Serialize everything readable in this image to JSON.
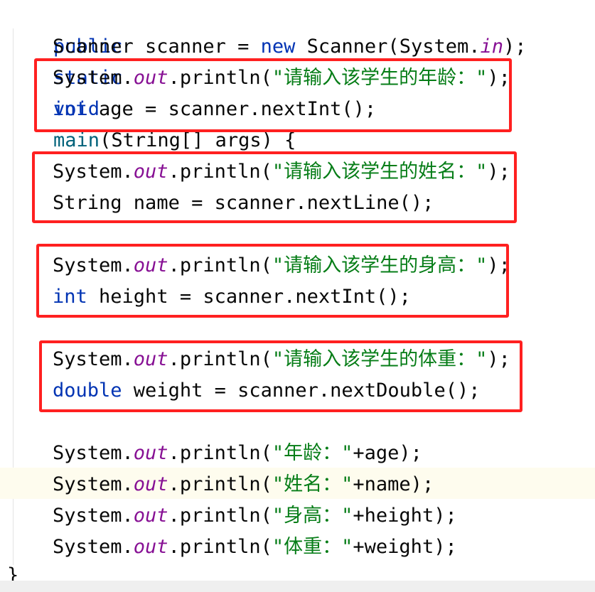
{
  "code": {
    "method_signature": {
      "kw_public": "public",
      "kw_static": "static",
      "kw_void": "void",
      "name": "main",
      "params": "(String[] args) {"
    },
    "scanner_decl": {
      "type": "Scanner scanner = ",
      "kw_new": "new",
      "ctor": " Scanner(System.",
      "field_in": "in",
      "end": ");"
    },
    "print_prefix": "System.",
    "field_out": "out",
    "println_open": ".println(",
    "blocks": [
      {
        "prompt": "\"请输入该学生的年龄：\"",
        "prompt_close": ");",
        "decl_type": "int",
        "decl_rest": " age = scanner.nextInt();"
      },
      {
        "prompt": "\"请输入该学生的姓名：\"",
        "prompt_close": ");",
        "decl_type": "String",
        "decl_rest": " name = scanner.nextLine();"
      },
      {
        "prompt": "\"请输入该学生的身高：\"",
        "prompt_close": ");",
        "decl_type": "int",
        "decl_rest": " height = scanner.nextInt();"
      },
      {
        "prompt": "\"请输入该学生的体重：\"",
        "prompt_close": ");",
        "decl_type": "double",
        "decl_rest": " weight = scanner.nextDouble();"
      }
    ],
    "outputs": [
      {
        "label": "\"年龄：\"",
        "rest": "+age);"
      },
      {
        "label": "\"姓名：\"",
        "rest": "+name);"
      },
      {
        "label": "\"身高：\"",
        "rest": "+height);"
      },
      {
        "label": "\"体重：\"",
        "rest": "+weight);"
      }
    ],
    "closing_brace": "}"
  },
  "colors": {
    "keyword": "#0033b3",
    "method_name": "#00627a",
    "static_field": "#871094",
    "string": "#067d17",
    "highlight_box": "#ff2020",
    "current_line": "#fefcee"
  }
}
